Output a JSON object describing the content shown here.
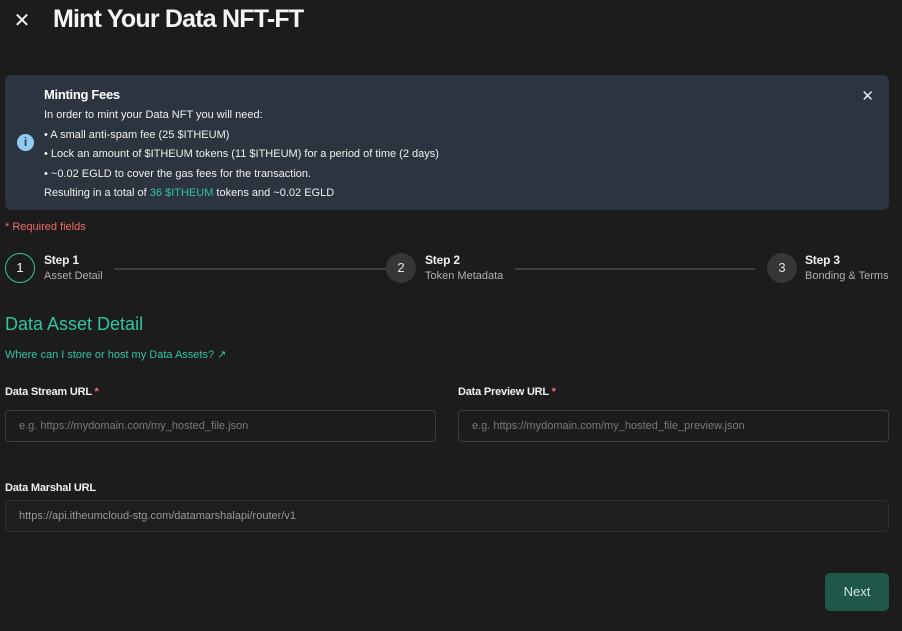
{
  "header": {
    "close_symbol": "✕",
    "title": "Mint Your Data NFT-FT"
  },
  "fees": {
    "heading": "Minting Fees",
    "info_symbol": "i",
    "close_symbol": "✕",
    "intro": "In order to mint your Data NFT you will need:",
    "bullets": [
      "• A small anti-spam fee (25 $ITHEUM)",
      "• Lock an amount of $ITHEUM tokens (11 $ITHEUM) for a period of time (2 days)",
      "• ~0.02 EGLD to cover the gas fees for the transaction."
    ],
    "total_prefix": "Resulting in a total of ",
    "total_accent": "36 $ITHEUM",
    "total_suffix": " tokens and ~0.02 EGLD"
  },
  "form": {
    "required_note": "*  Required fields",
    "section_title": "Data Asset Detail",
    "storage_link": "Where can I store or host my Data Assets?",
    "storage_link_icon": "↗",
    "data_stream_label": "Data Stream URL",
    "data_stream_placeholder": "e.g. https://mydomain.com/my_hosted_file.json",
    "data_preview_label": "Data Preview URL",
    "data_preview_placeholder": "e.g. https://mydomain.com/my_hosted_file_preview.json",
    "data_marshal_label": "Data Marshal URL",
    "data_marshal_value": "https://api.itheumcloud-stg.com/datamarshalapi/router/v1",
    "required_star": "*",
    "next_label": "Next"
  },
  "steps": [
    {
      "number": "1",
      "title": "Step 1",
      "desc": "Asset Detail",
      "active": true
    },
    {
      "number": "2",
      "title": "Step 2",
      "desc": "Token Metadata",
      "active": false
    },
    {
      "number": "3",
      "title": "Step 3",
      "desc": "Bonding & Terms",
      "active": false
    }
  ],
  "colors": {
    "accent": "#2fc5a0",
    "required": "#f06c6c",
    "info_bg": "#2c3440",
    "page_bg": "#1c1c1c"
  },
  "icons": {
    "close": "close-icon",
    "info": "info-icon",
    "external_link": "external-link-icon"
  }
}
